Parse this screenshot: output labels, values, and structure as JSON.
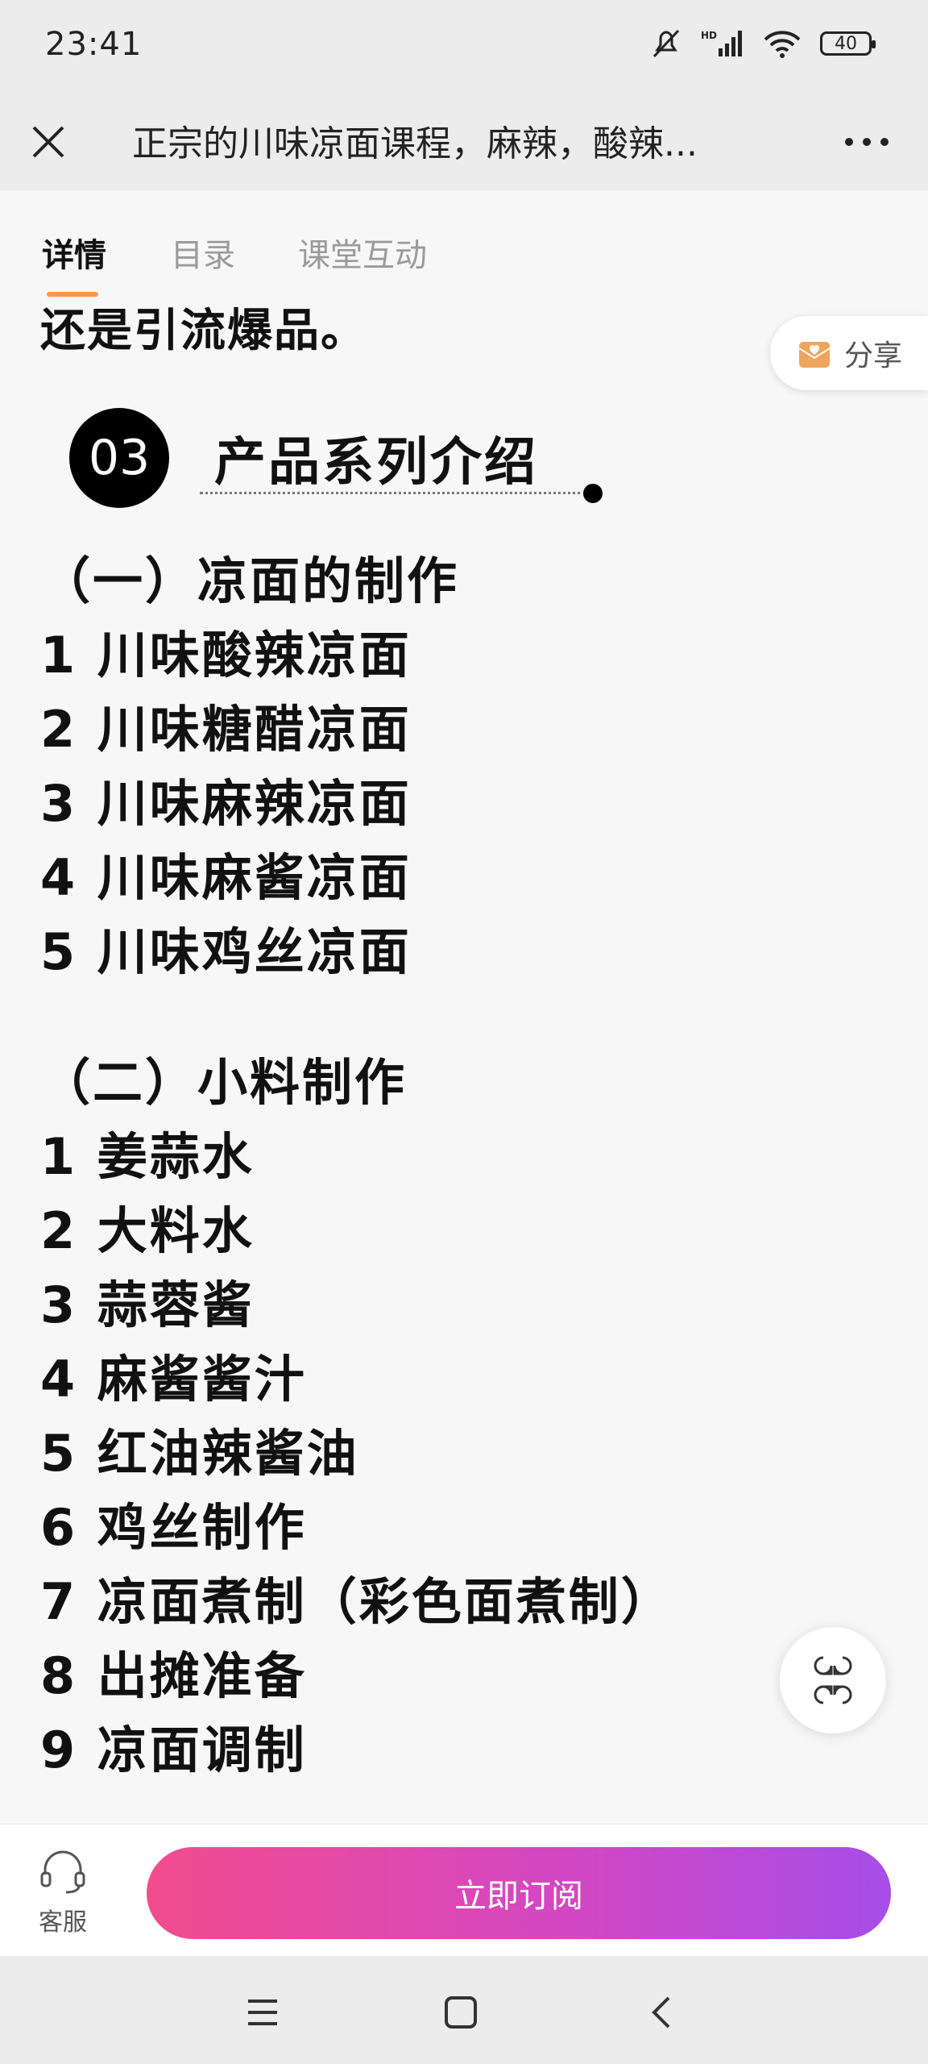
{
  "status_bar": {
    "time": "23:41",
    "battery": "40"
  },
  "app_bar": {
    "title": "正宗的川味凉面课程，麻辣，酸辣..."
  },
  "tabs": [
    {
      "label": "详情",
      "active": true
    },
    {
      "label": "目录",
      "active": false
    },
    {
      "label": "课堂互动",
      "active": false
    }
  ],
  "share": {
    "label": "分享"
  },
  "content": {
    "partial_text": "还是引流爆品。",
    "section_number": "03",
    "section_title": "产品系列介绍",
    "group1": {
      "title": "（一）凉面的制作",
      "items": [
        "1 川味酸辣凉面",
        "2 川味糖醋凉面",
        "3 川味麻辣凉面",
        "4 川味麻酱凉面",
        "5 川味鸡丝凉面"
      ]
    },
    "group2": {
      "title": "（二）小料制作",
      "items": [
        "1 姜蒜水",
        "2 大料水",
        "3 蒜蓉酱",
        "4 麻酱酱汁",
        "5 红油辣酱油",
        "6 鸡丝制作",
        "7 凉面煮制（彩色面煮制）",
        "8 出摊准备",
        "9 凉面调制"
      ]
    }
  },
  "bottom_bar": {
    "service_label": "客服",
    "subscribe_label": "立即订阅"
  },
  "icons": {
    "close": "close-icon",
    "more": "more-icon",
    "share": "share-icon",
    "grid": "grid-menu-icon",
    "service": "headset-icon",
    "nav_menu": "menu-icon",
    "nav_home": "home-icon",
    "nav_back": "back-icon"
  },
  "colors": {
    "accent_underline": "#f19a57",
    "subscribe_gradient_start": "#f24c8e",
    "subscribe_gradient_end": "#a64de8"
  }
}
